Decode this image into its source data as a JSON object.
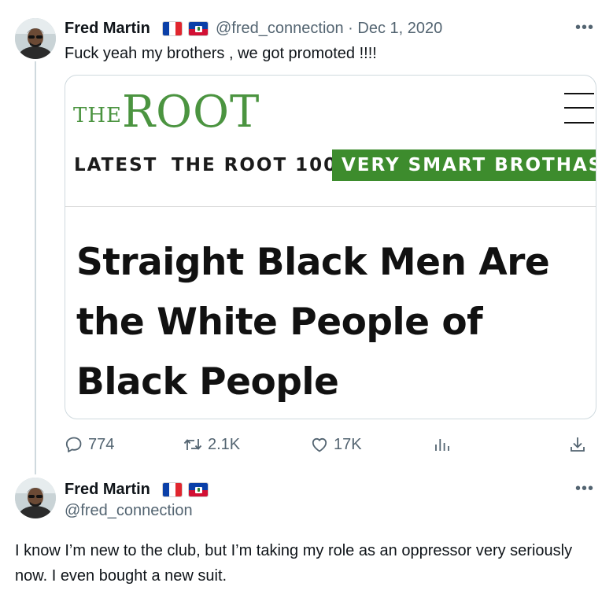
{
  "tweet1": {
    "author_name": "Fred Martin",
    "handle_date": "@fred_connection · Dec 1, 2020",
    "text": "Fuck yeah my brothers , we got promoted !!!!",
    "more": "•••",
    "card": {
      "logo_small": "THE",
      "logo_big": "ROOT",
      "nav": [
        "LATEST",
        "THE ROOT 100",
        "VERY SMART BROTHAS"
      ],
      "headline": "Straight Black Men Are the White People of Black People"
    },
    "actions": {
      "replies": "774",
      "retweets": "2.1K",
      "likes": "17K"
    }
  },
  "tweet2": {
    "author_name": "Fred Martin",
    "handle": "@fred_connection",
    "more": "•••",
    "text": "I know I’m new to the club, but I’m taking my role as an oppressor very seriously now. I even bought a new suit."
  },
  "colors": {
    "accent_green": "#3d8c2d",
    "logo_green": "#4b9440",
    "muted": "#536471"
  },
  "icons": [
    "avatar",
    "france-flag",
    "haiti-flag",
    "more-icon",
    "hamburger-menu-icon",
    "reply-icon",
    "retweet-icon",
    "like-icon",
    "analytics-icon",
    "share-icon"
  ]
}
